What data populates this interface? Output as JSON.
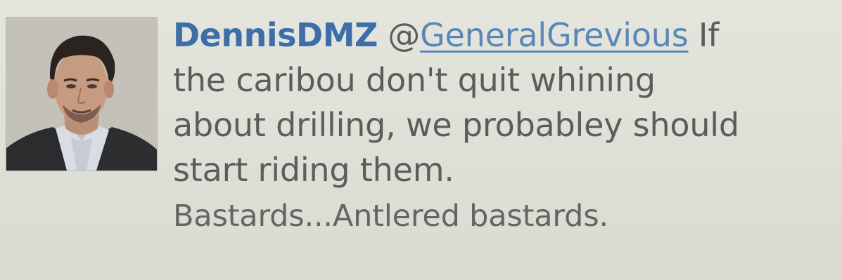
{
  "tweet": {
    "username": "DennisDMZ",
    "mention_prefix": "@",
    "mention_handle": "GeneralGrevious",
    "line1_tail": " If",
    "line2": "the caribou don't quit whining",
    "line3": "about drilling, we probabley should",
    "line4": "start riding them.",
    "line5": "Bastards...Antlered bastards."
  },
  "avatar": {
    "icon": "user-avatar-photo"
  }
}
